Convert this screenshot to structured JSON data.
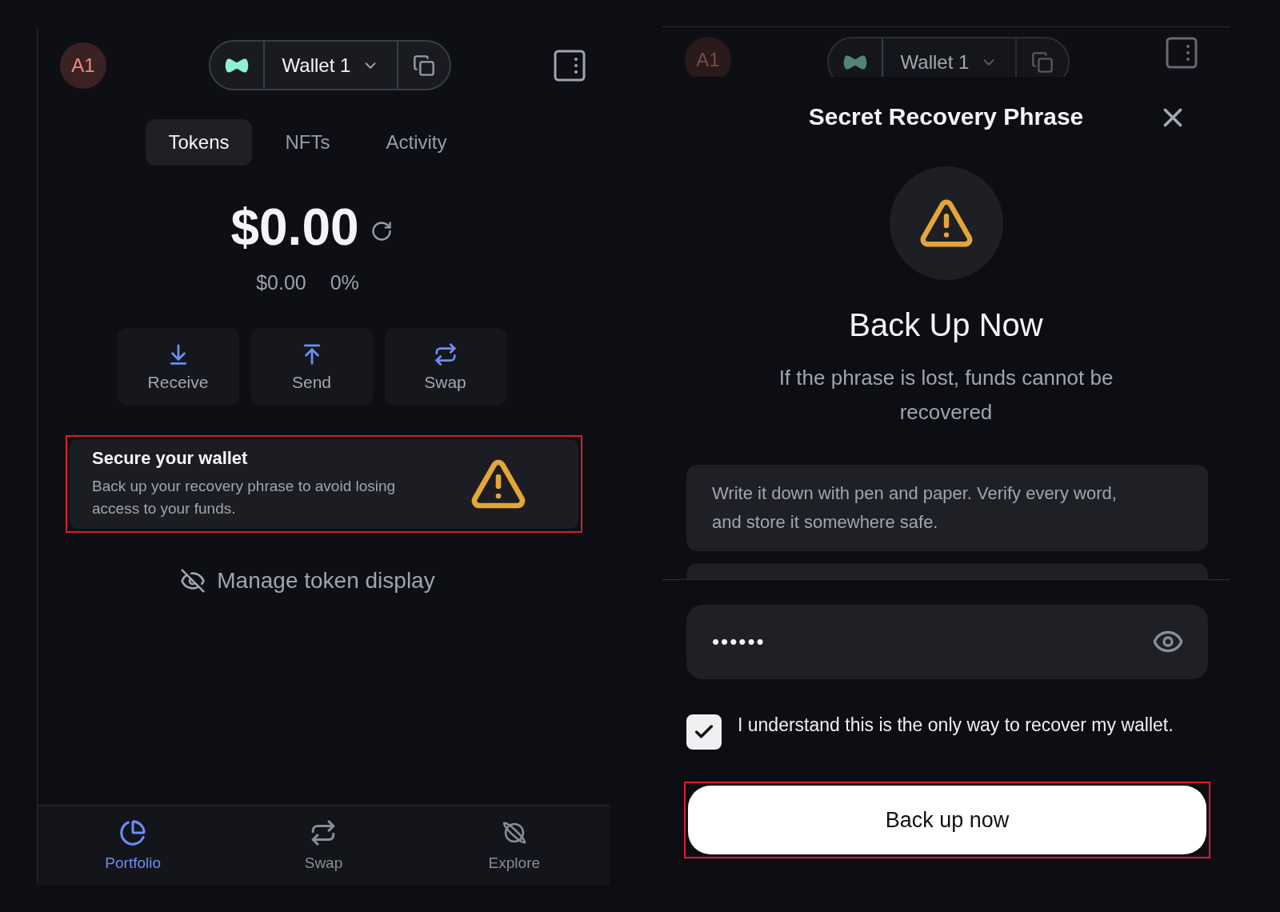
{
  "wallet_screen": {
    "avatar": "A1",
    "wallet_name": "Wallet 1",
    "tabs": [
      {
        "label": "Tokens",
        "selected": true
      },
      {
        "label": "NFTs",
        "selected": false
      },
      {
        "label": "Activity",
        "selected": false
      }
    ],
    "balance": "$0.00",
    "change_amount": "$0.00",
    "change_percent": "0%",
    "actions": [
      {
        "kind": "receive",
        "label": "Receive"
      },
      {
        "kind": "send",
        "label": "Send"
      },
      {
        "kind": "swap",
        "label": "Swap"
      }
    ],
    "backup_card": {
      "title": "Secure your wallet",
      "text": "Back up your recovery phrase to avoid losing access to your funds.",
      "highlighted": true
    },
    "manage_link": "Manage token display",
    "nav": [
      {
        "kind": "portfolio",
        "label": "Portfolio",
        "selected": true
      },
      {
        "kind": "swap",
        "label": "Swap",
        "selected": false
      },
      {
        "kind": "explore",
        "label": "Explore",
        "selected": false
      }
    ]
  },
  "recovery_sheet": {
    "backdrop": {
      "avatar": "A1",
      "wallet_name": "Wallet 1"
    },
    "title": "Secret Recovery Phrase",
    "heading": "Back Up Now",
    "subtitle": "If the phrase is lost, funds cannot be recovered",
    "tip": "Write it down with pen and paper. Verify every word, and store it somewhere safe.",
    "password": {
      "value": "••••••"
    },
    "acknowledge": {
      "label": "I understand this is the only way to recover my wallet.",
      "checked": true
    },
    "button": {
      "label": "Back up now",
      "highlighted": true
    }
  }
}
